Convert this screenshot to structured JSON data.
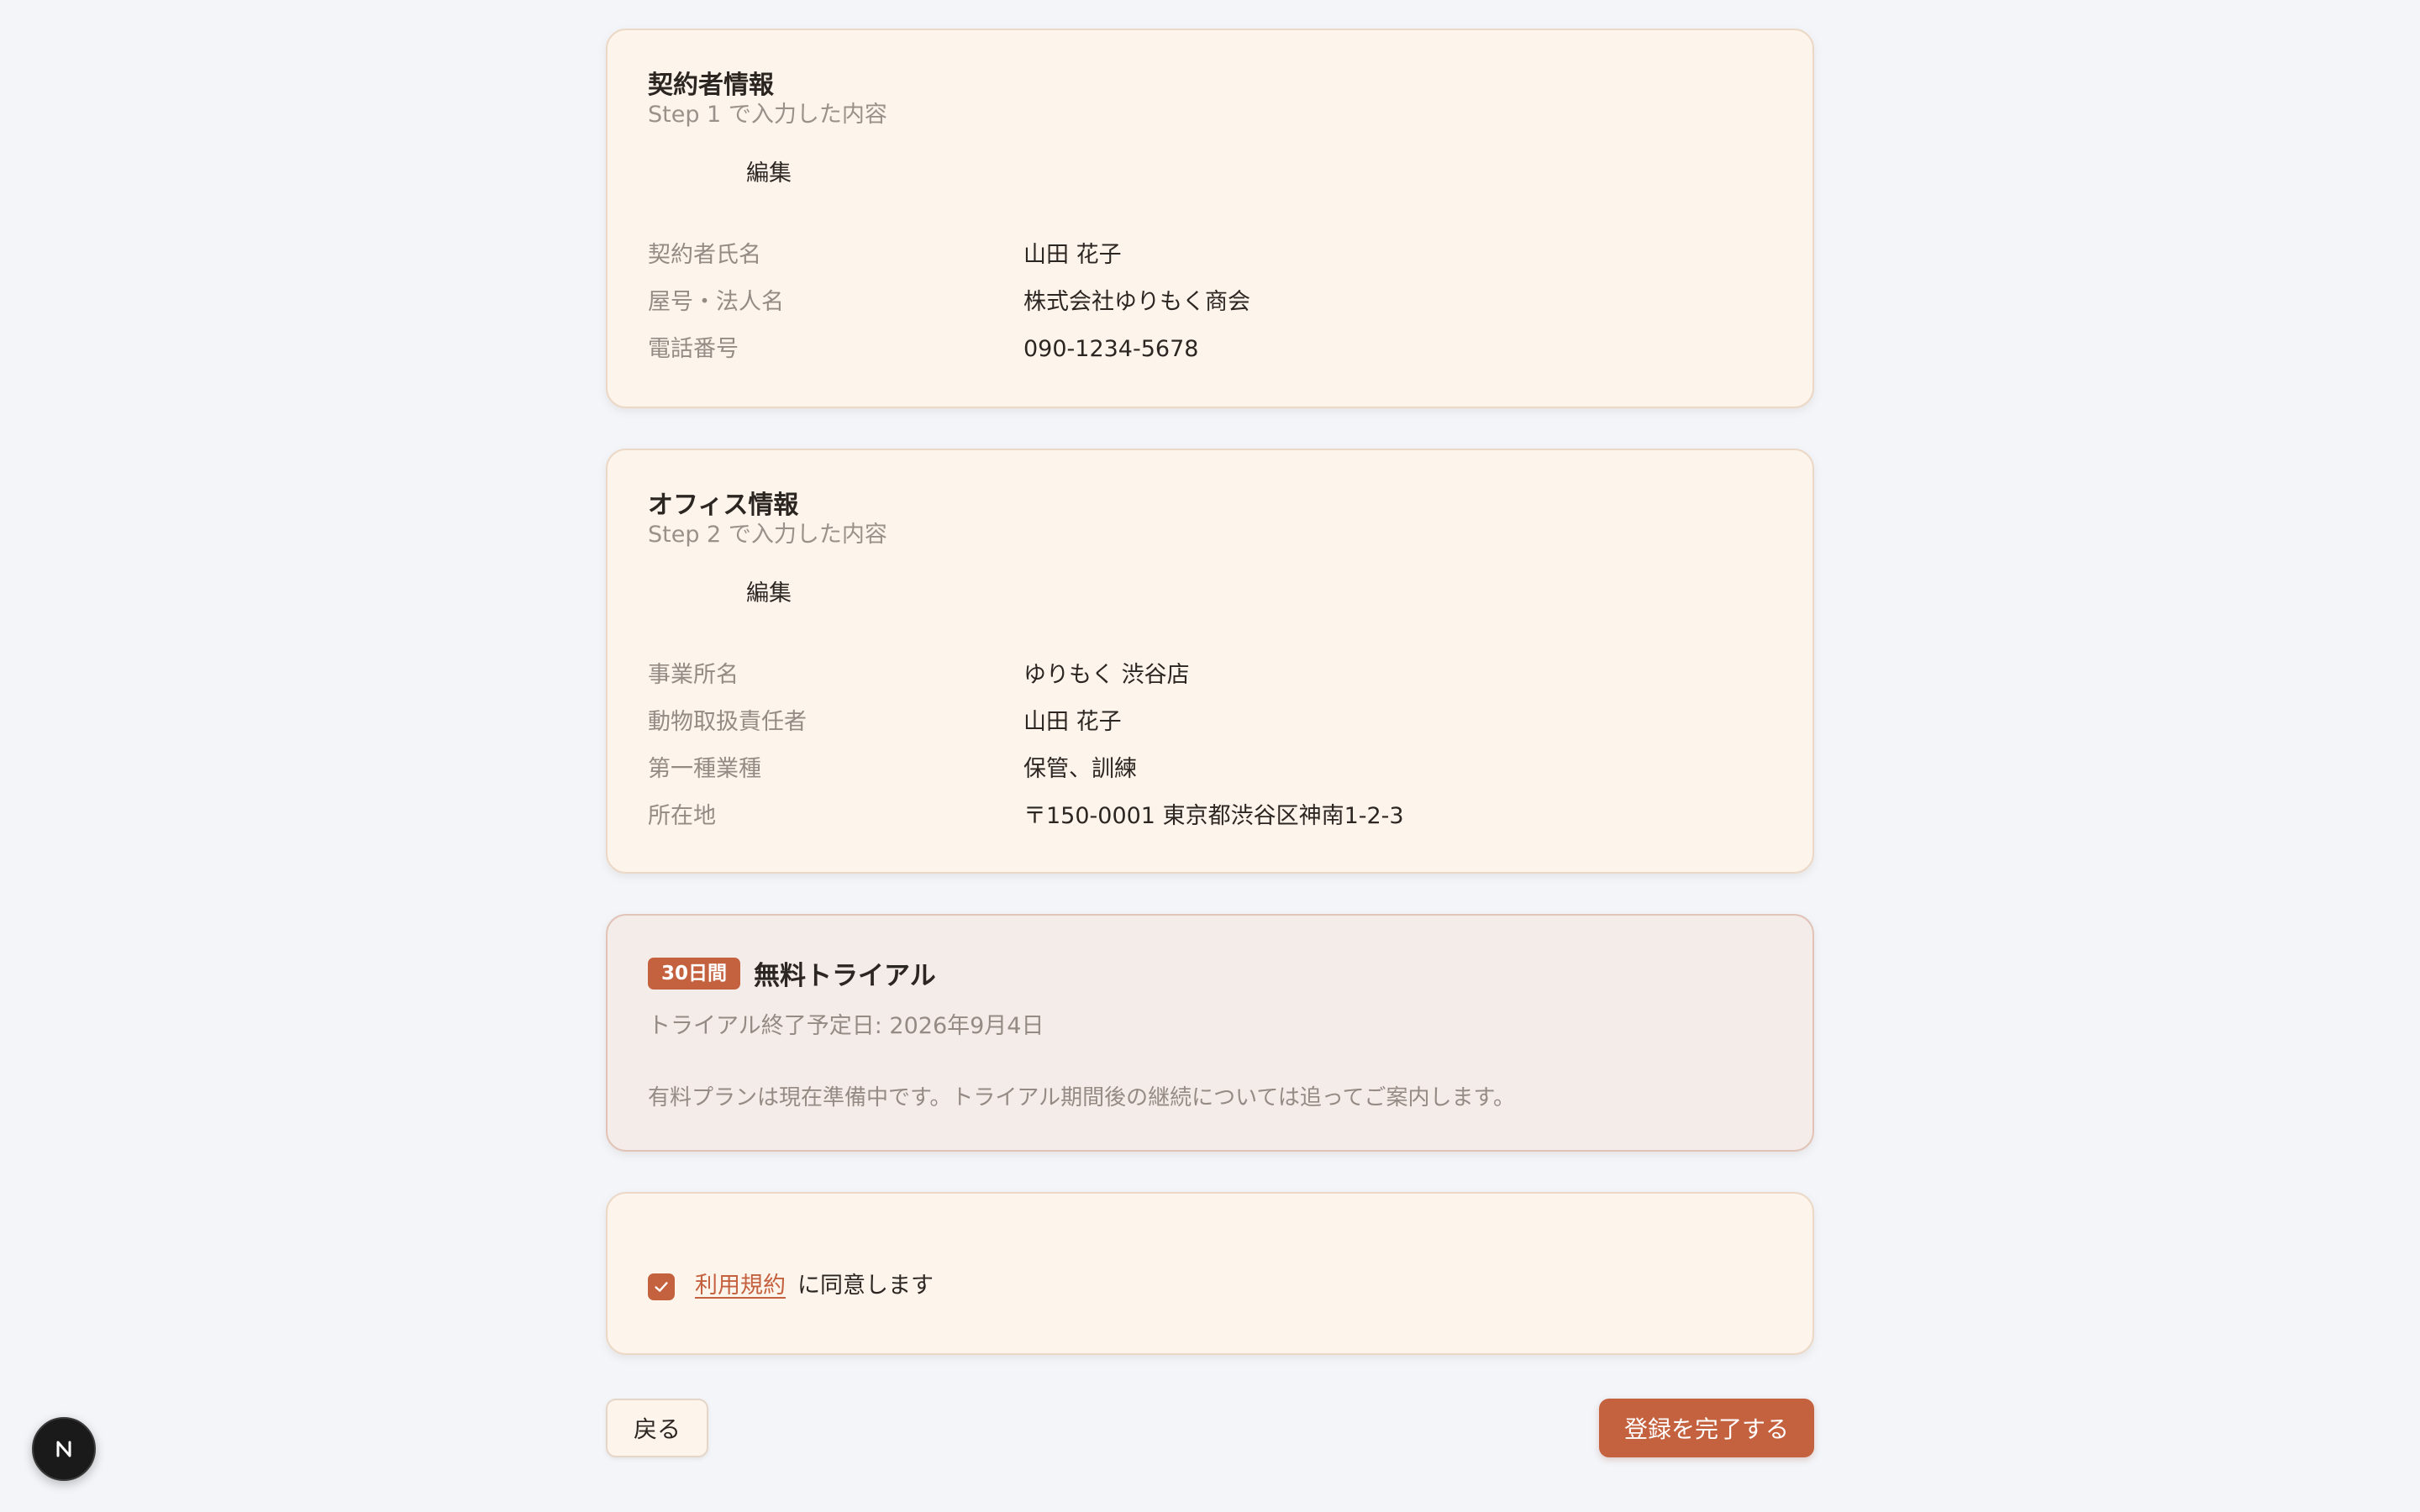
{
  "contractor": {
    "title": "契約者情報",
    "subtitle": "Step 1 で入力した内容",
    "edit_label": "編集",
    "rows": [
      {
        "label": "契約者氏名",
        "value": "山田 花子"
      },
      {
        "label": "屋号・法人名",
        "value": "株式会社ゆりもく商会"
      },
      {
        "label": "電話番号",
        "value": "090-1234-5678"
      }
    ]
  },
  "office": {
    "title": "オフィス情報",
    "subtitle": "Step 2 で入力した内容",
    "edit_label": "編集",
    "rows": [
      {
        "label": "事業所名",
        "value": "ゆりもく 渋谷店"
      },
      {
        "label": "動物取扱責任者",
        "value": "山田 花子"
      },
      {
        "label": "第一種業種",
        "value": "保管、訓練"
      },
      {
        "label": "所在地",
        "value": "〒150-0001 東京都渋谷区神南1-2-3"
      }
    ]
  },
  "trial": {
    "badge": "30日間",
    "title": "無料トライアル",
    "end_date": "トライアル終了予定日: 2026年9月4日",
    "note": "有料プランは現在準備中です。トライアル期間後の継続については追ってご案内します。"
  },
  "terms": {
    "checked": true,
    "link_text": "利用規約",
    "suffix": "に同意します"
  },
  "actions": {
    "back_label": "戻る",
    "complete_label": "登録を完了する"
  },
  "next_badge": {
    "letter": "N",
    "icon": "nextjs-icon"
  },
  "colors": {
    "accent": "#c4613f",
    "card_bg": "#fdf5ec",
    "page_bg": "#f3f5f9"
  }
}
